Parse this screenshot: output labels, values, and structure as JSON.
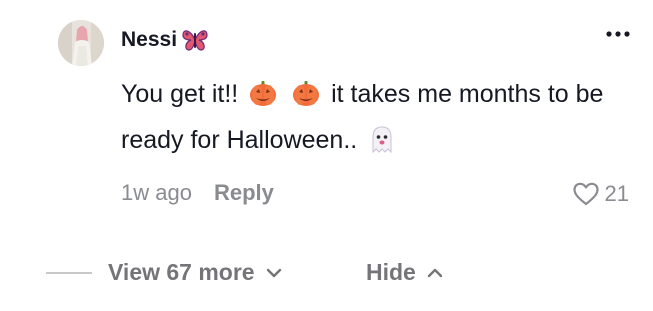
{
  "comment": {
    "username": "Nessi",
    "username_badge_icon": "butterfly-icon",
    "text_part1": "You get it!!",
    "emoji_1": "pumpkin-icon",
    "emoji_2": "pumpkin-icon",
    "text_part2": "it takes me months to be ready for Halloween..",
    "emoji_3": "ghost-icon",
    "timestamp": "1w ago",
    "reply_label": "Reply",
    "like_count": "21",
    "more_icon": "more-options-icon"
  },
  "thread": {
    "view_more_label": "View 67 more",
    "hide_label": "Hide"
  },
  "colors": {
    "text_primary": "#161823",
    "text_secondary": "#8a8b91",
    "butterfly": "#e2576f",
    "pumpkin": "#f26b3a"
  }
}
